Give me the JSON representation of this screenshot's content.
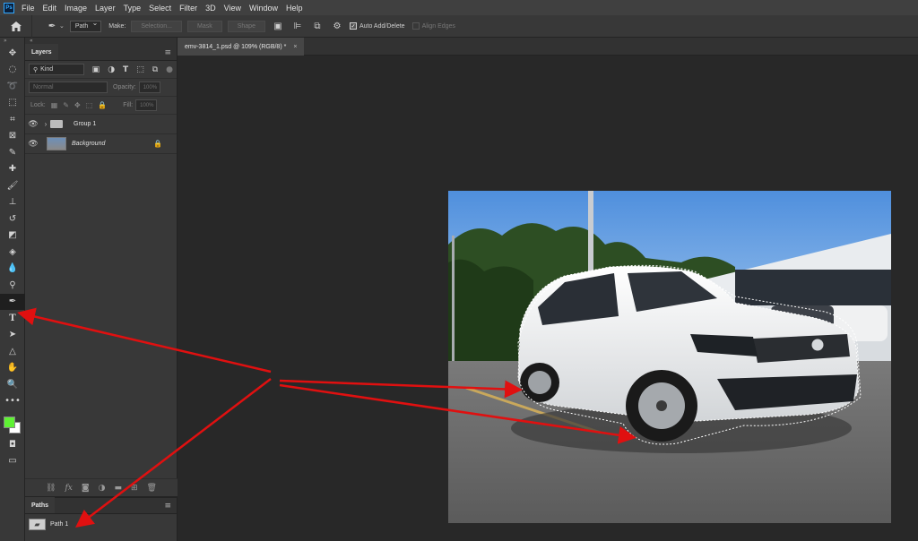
{
  "app": {
    "logo": "Ps"
  },
  "menu": [
    "File",
    "Edit",
    "Image",
    "Layer",
    "Type",
    "Select",
    "Filter",
    "3D",
    "View",
    "Window",
    "Help"
  ],
  "options": {
    "mode": "Path",
    "make_label": "Make:",
    "selection_btn": "Selection...",
    "mask_btn": "Mask",
    "shape_btn": "Shape",
    "auto_add_delete": "Auto Add/Delete",
    "align_edges": "Align Edges"
  },
  "layers_panel": {
    "tab": "Layers",
    "kind": "Kind",
    "blend_mode": "Normal",
    "opacity_label": "Opacity:",
    "opacity_value": "100%",
    "lock_label": "Lock:",
    "fill_label": "Fill:",
    "fill_value": "100%",
    "layers": [
      {
        "name": "Group 1"
      },
      {
        "name": "Background"
      }
    ]
  },
  "paths_panel": {
    "tab": "Paths",
    "items": [
      {
        "name": "Path 1"
      }
    ]
  },
  "document": {
    "tab_title": "emv-3814_1.psd @ 109% (RGB/8) *"
  },
  "colors": {
    "foreground": "#5ff234",
    "background": "#ffffff",
    "arrow": "#e01010"
  }
}
